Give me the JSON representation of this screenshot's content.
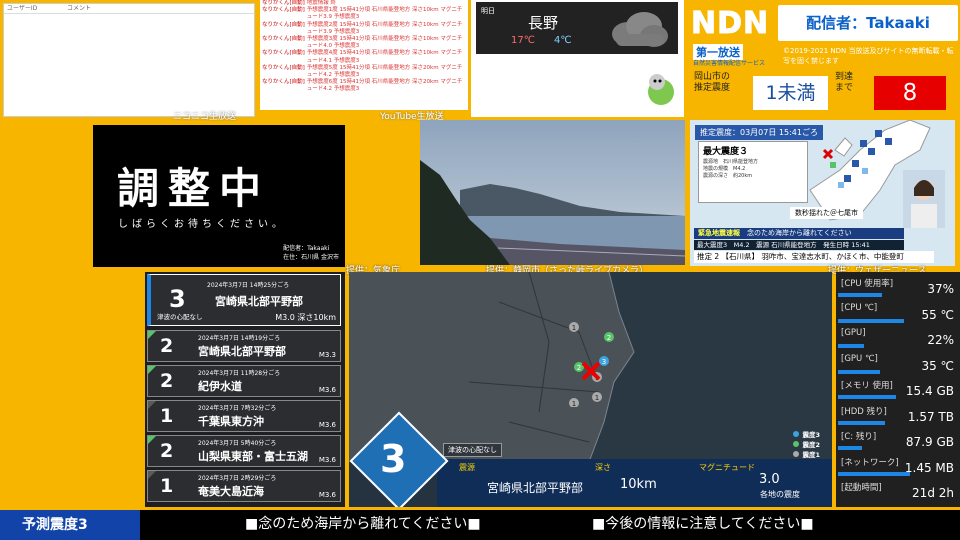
{
  "nico_chat": {
    "col_user": "ユーザーID",
    "col_comment": "コメント",
    "caption": "ニコニコ生放送"
  },
  "youtube_chat": {
    "caption": "YouTube生放送",
    "rows": [
      {
        "user": "なりかくん[自動]",
        "msg": "地震情報 終"
      },
      {
        "user": "なりかくん[自動]",
        "msg": "予想震度1度 15時41分頃 石川県能登地方 深さ10km マグニチュード3.9 予想震度3"
      },
      {
        "user": "なりかくん[自動]",
        "msg": "予想震度2度 15時41分頃 石川県能登地方 深さ10km マグニチュード3.9 予想震度3"
      },
      {
        "user": "なりかくん[自動]",
        "msg": "予想震度3度 15時41分頃 石川県能登地方 深さ10km マグニチュード4.0 予想震度3"
      },
      {
        "user": "なりかくん[自動]",
        "msg": "予想震度4度 15時41分頃 石川県能登地方 深さ10km マグニチュード4.1 予想震度3"
      },
      {
        "user": "なりかくん[自動]",
        "msg": "予想震度5度 15時41分頃 石川県能登地方 深さ20km マグニチュード4.2 予想震度3"
      },
      {
        "user": "なりかくん[自動]",
        "msg": "予想震度6度 15時41分頃 石川県能登地方 深さ20km マグニチュード4.2 予想震度3"
      }
    ]
  },
  "weather": {
    "label": "明日",
    "city": "長野",
    "high": "17℃",
    "low": "4℃"
  },
  "ndn": {
    "logo": "NDN",
    "caster": "配信者：Takaaki",
    "first": "第一放送",
    "sub": "自然災害情報配信サービス",
    "copyright": "©2019-2021 NDN 当放送及びサイトの無断転載・転写を固く禁じます",
    "pre_label1": "岡山市の",
    "pre_label2": "推定震度",
    "intensity": "1未満",
    "arr_label1": "到達",
    "arr_label2": "まで",
    "countdown": "8"
  },
  "pause": {
    "big": "調整中",
    "wait": "しばらくお待ちください。",
    "rec1": "配信者：Takaaki",
    "rec2": "在住：石川県 金沢市"
  },
  "captions": {
    "cam": "提供：気象庁",
    "cam2": "提供：静岡市（さった峠ライブカメラ）",
    "nhk": "提供：ウェザーニュース"
  },
  "nhk": {
    "est_title": "推定震度：03月07日 15:41ごろ",
    "max": "最大震度３",
    "d1": "震源地　石川県能登地方",
    "d2": "地震の規模　M4.2",
    "d3": "震源の深さ　約20km",
    "shake": "数秒揺れた＠七尾市",
    "warn_label": "緊急地震速報",
    "warn_msg": "念のため海岸から離れてください",
    "info": "最大震度3　M4.2　震源 石川県能登地方　発生日時 15:41",
    "areas": "推定 2 【石川県】 羽咋市、宝達志水町、かほく市、中能登町"
  },
  "eq_list": [
    {
      "int": "3",
      "time": "2024年3月7日 14時25分ごろ",
      "place": "宮崎県北部平野部",
      "tsunami": "津波の心配なし",
      "mag": "M3.0 深さ10km"
    },
    {
      "int": "2",
      "time": "2024年3月7日 14時19分ごろ",
      "place": "宮崎県北部平野部",
      "mag": "M3.3"
    },
    {
      "int": "2",
      "time": "2024年3月7日 11時28分ごろ",
      "place": "紀伊水道",
      "mag": "M3.6"
    },
    {
      "int": "1",
      "time": "2024年3月7日 7時32分ごろ",
      "place": "千葉県東方沖",
      "mag": "M3.6"
    },
    {
      "int": "2",
      "time": "2024年3月7日 5時40分ごろ",
      "place": "山梨県東部・富士五湖",
      "mag": "M3.6"
    },
    {
      "int": "1",
      "time": "2024年3月7日 2時29分ごろ",
      "place": "奄美大島近海",
      "mag": "M3.6"
    }
  ],
  "map": {
    "int": "3",
    "tsunami": "津波の心配なし",
    "l_src": "震源",
    "src": "宮崎県北部平野部",
    "l_depth": "深さ",
    "depth": "10km",
    "l_mag": "マグニチュード",
    "mag": "3.0",
    "l_each": "各地の震度",
    "legend": [
      {
        "label": "震度3",
        "color": "#3ba3e0"
      },
      {
        "label": "震度2",
        "color": "#59c36a"
      },
      {
        "label": "震度1",
        "color": "#aaaaaa"
      }
    ]
  },
  "sys": [
    {
      "k": "[CPU 使用率]",
      "v": "37%",
      "pct": 0.37
    },
    {
      "k": "[CPU ℃]",
      "v": "55 ℃",
      "pct": 0.55
    },
    {
      "k": "[GPU]",
      "v": "22%",
      "pct": 0.22
    },
    {
      "k": "[GPU ℃]",
      "v": "35 ℃",
      "pct": 0.35
    },
    {
      "k": "[メモリ 使用]",
      "v": "15.4 GB",
      "pct": 0.48
    },
    {
      "k": "[HDD 残り]",
      "v": "1.57 TB",
      "pct": 0.39
    },
    {
      "k": "[C: 残り]",
      "v": "87.9 GB",
      "pct": 0.2
    },
    {
      "k": "[ネットワーク]",
      "v": "1.45 MB",
      "pct": 0.6
    },
    {
      "k": "[起動時間]",
      "v": "21d 2h",
      "pct": 0
    }
  ],
  "ticker": {
    "pred": "予測震度3",
    "m1": "■念のため海岸から離れてください■",
    "m2": "■今後の情報に注意してください■"
  }
}
